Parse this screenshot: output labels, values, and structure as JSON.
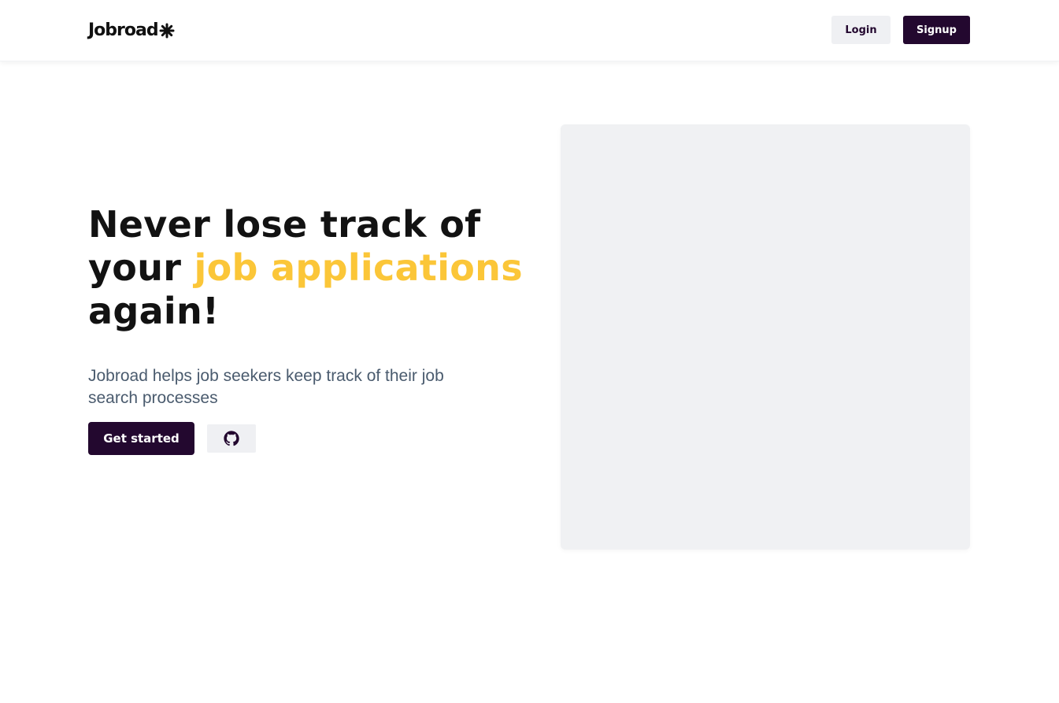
{
  "navbar": {
    "logo_text": "Jobroad",
    "logo_icon": "asterisk-icon",
    "login_label": "Login",
    "signup_label": "Signup"
  },
  "hero": {
    "title_part1": "Never lose track of your ",
    "title_accent": "job applications",
    "title_part2": " again!",
    "subtitle": "Jobroad helps job seekers keep track of their job search processes",
    "get_started_label": "Get started",
    "github_icon": "github-icon"
  },
  "colors": {
    "brand_dark": "#23082f",
    "accent_yellow": "#fbc638",
    "button_light": "#eff0f3",
    "image_placeholder": "#f0f1f3",
    "subtitle_text": "#4a5b6e"
  }
}
